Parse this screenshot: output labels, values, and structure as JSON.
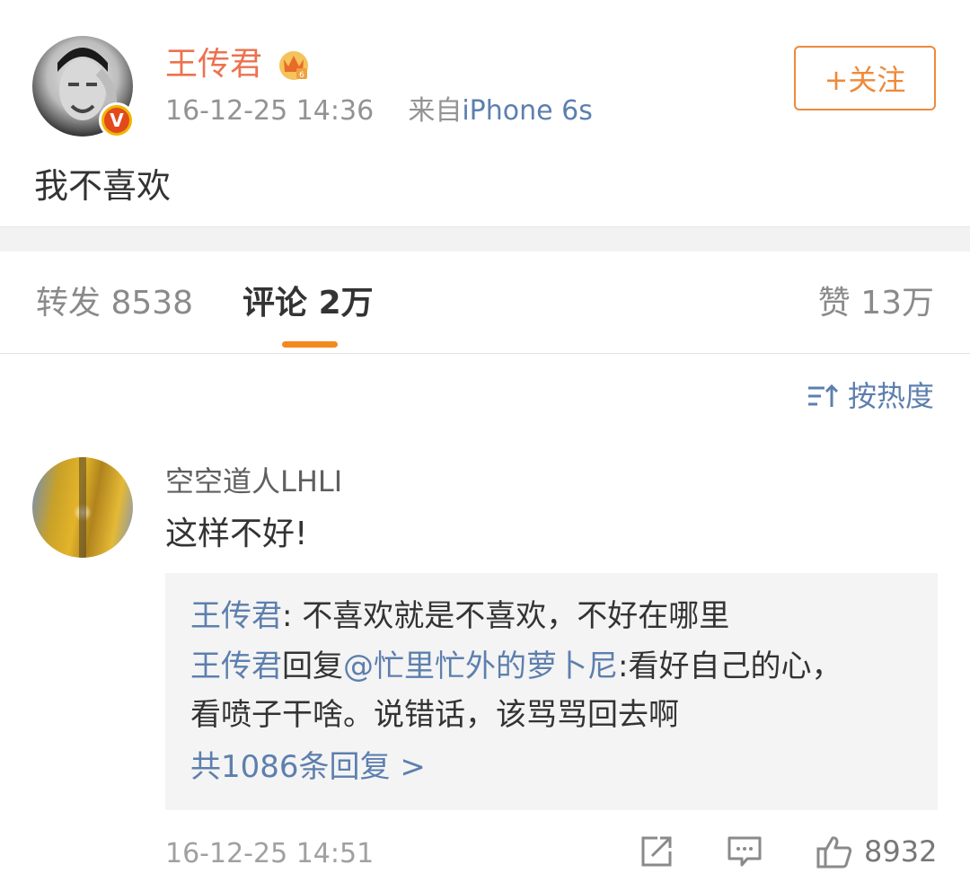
{
  "post": {
    "author": "王传君",
    "timestamp": "16-12-25 14:36",
    "source_prefix": "来自",
    "source_device": "iPhone 6s",
    "follow_label": "+关注",
    "text": "我不喜欢",
    "verified_badge": "V",
    "avatar_icon": "user-avatar",
    "crown_icon": "member-crown-icon"
  },
  "tabs": {
    "repost_label": "转发",
    "repost_count": "8538",
    "comment_label": "评论",
    "comment_count": "2万",
    "like_label": "赞",
    "like_count": "13万"
  },
  "sort": {
    "label": "按热度"
  },
  "comment": {
    "author": "空空道人LHLI",
    "text": "这样不好!",
    "replies": [
      {
        "author": "王传君",
        "separator": ": ",
        "text": "不喜欢就是不喜欢，不好在哪里"
      },
      {
        "author": "王传君",
        "reply_word": "回复",
        "mention": "@忙里忙外的萝卜尼",
        "separator": ":",
        "text_line1": "看好自己的心，",
        "text_line2": "看喷子干啥。说错话，该骂骂回去啊"
      }
    ],
    "more_replies": "共1086条回复 >",
    "timestamp": "16-12-25 14:51",
    "like_count": "8932"
  },
  "colors": {
    "username_orange": "#eb7350",
    "follow_orange": "#ee8a3a",
    "link_blue": "#5d7fae",
    "tab_indicator": "#f28a20",
    "reply_bg": "#f4f4f4",
    "divider_bg": "#f2f2f2"
  }
}
